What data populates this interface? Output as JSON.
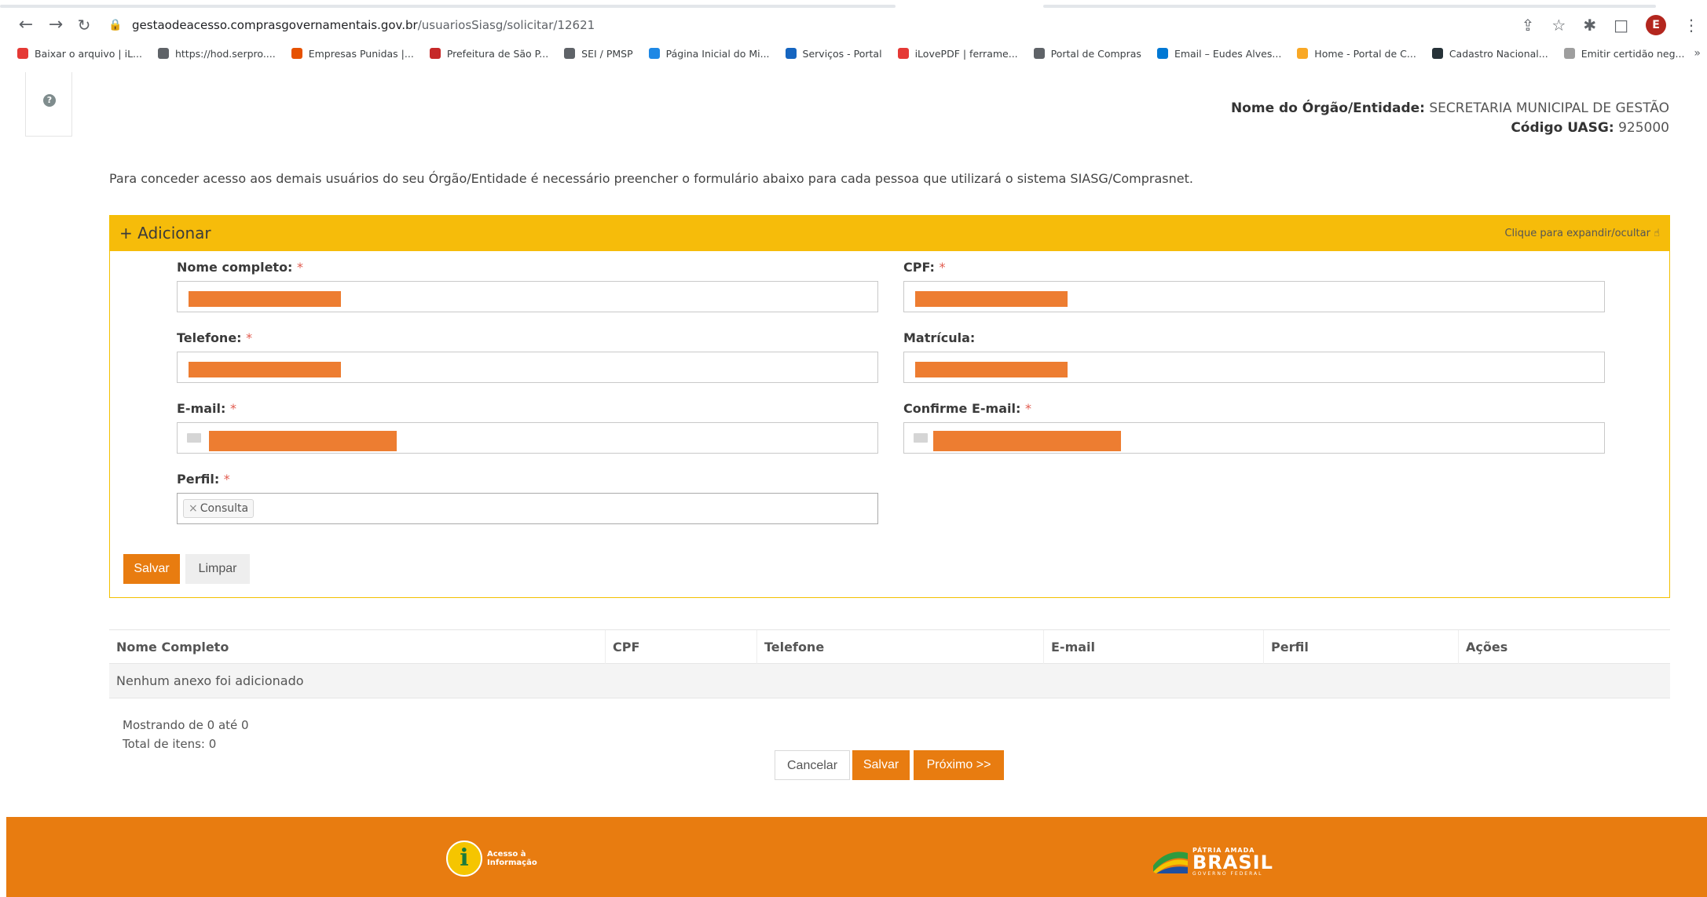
{
  "browser": {
    "back_icon": "arrow-left-icon",
    "forward_icon": "arrow-right-icon",
    "reload_icon": "reload-icon",
    "url_host": "gestaodeacesso.comprasgovernamentais.gov.br",
    "url_path": "/usuariosSiasg/solicitar/12621",
    "profile_initial": "E",
    "bookmarks": [
      {
        "label": "Baixar o arquivo | iL...",
        "color": "#e53935"
      },
      {
        "label": "https://hod.serpro....",
        "color": "#5f6368"
      },
      {
        "label": "Empresas Punidas |...",
        "color": "#e65100"
      },
      {
        "label": "Prefeitura de São P...",
        "color": "#c62828"
      },
      {
        "label": "SEI / PMSP",
        "color": "#5f6368"
      },
      {
        "label": "Página Inicial do Mi...",
        "color": "#1e88e5"
      },
      {
        "label": "Serviços - Portal",
        "color": "#1565c0"
      },
      {
        "label": "iLovePDF | ferrame...",
        "color": "#e53935"
      },
      {
        "label": "Portal de Compras",
        "color": "#5f6368"
      },
      {
        "label": "Email – Eudes Alves...",
        "color": "#0078d4"
      },
      {
        "label": "Home - Portal de C...",
        "color": "#f9a825"
      },
      {
        "label": "Cadastro Nacional...",
        "color": "#263238"
      },
      {
        "label": "Emitir certidão neg...",
        "color": "#9e9e9e"
      }
    ],
    "more_label": "»"
  },
  "header": {
    "org_label": "Nome do Órgão/Entidade:",
    "org_value": " SECRETARIA MUNICIPAL DE GESTÃO",
    "uasg_label": "Código UASG:",
    "uasg_value": " 925000",
    "help_icon": "?"
  },
  "intro": "Para conceder acesso aos demais usuários do seu Órgão/Entidade é necessário preencher o formulário abaixo para cada pessoa que utilizará o sistema SIASG/Comprasnet.",
  "form": {
    "title": "+ Adicionar",
    "toggle": "Clique para expandir/ocultar ☝",
    "fields": {
      "nome": {
        "label": "Nome completo:",
        "required": "*"
      },
      "cpf": {
        "label": "CPF:",
        "required": "*"
      },
      "telefone": {
        "label": "Telefone:",
        "required": "*"
      },
      "matricula": {
        "label": "Matrícula:"
      },
      "email": {
        "label": "E-mail:",
        "required": "*"
      },
      "confirme_email": {
        "label": "Confirme E-mail:",
        "required": "*"
      },
      "perfil": {
        "label": "Perfil:",
        "required": "*",
        "selected": "Consulta",
        "remove": "×"
      }
    },
    "redaction_color": "#ed7d31",
    "salvar": "Salvar",
    "limpar": "Limpar"
  },
  "table": {
    "columns": [
      "Nome Completo",
      "CPF",
      "Telefone",
      "E-mail",
      "Perfil",
      "Ações"
    ],
    "empty": "Nenhum anexo foi adicionado"
  },
  "pagination": {
    "showing": "Mostrando de 0 até 0",
    "total": "Total de itens: 0"
  },
  "actions": {
    "cancelar": "Cancelar",
    "salvar": "Salvar",
    "proximo": "Próximo >>"
  },
  "footer": {
    "acesso_line1": "Acesso à",
    "acesso_line2": "Informação",
    "brasil_top": "PÁTRIA AMADA",
    "brasil_main": "BRASIL",
    "brasil_sub": "GOVERNO FEDERAL",
    "accent": "#e87c10"
  }
}
